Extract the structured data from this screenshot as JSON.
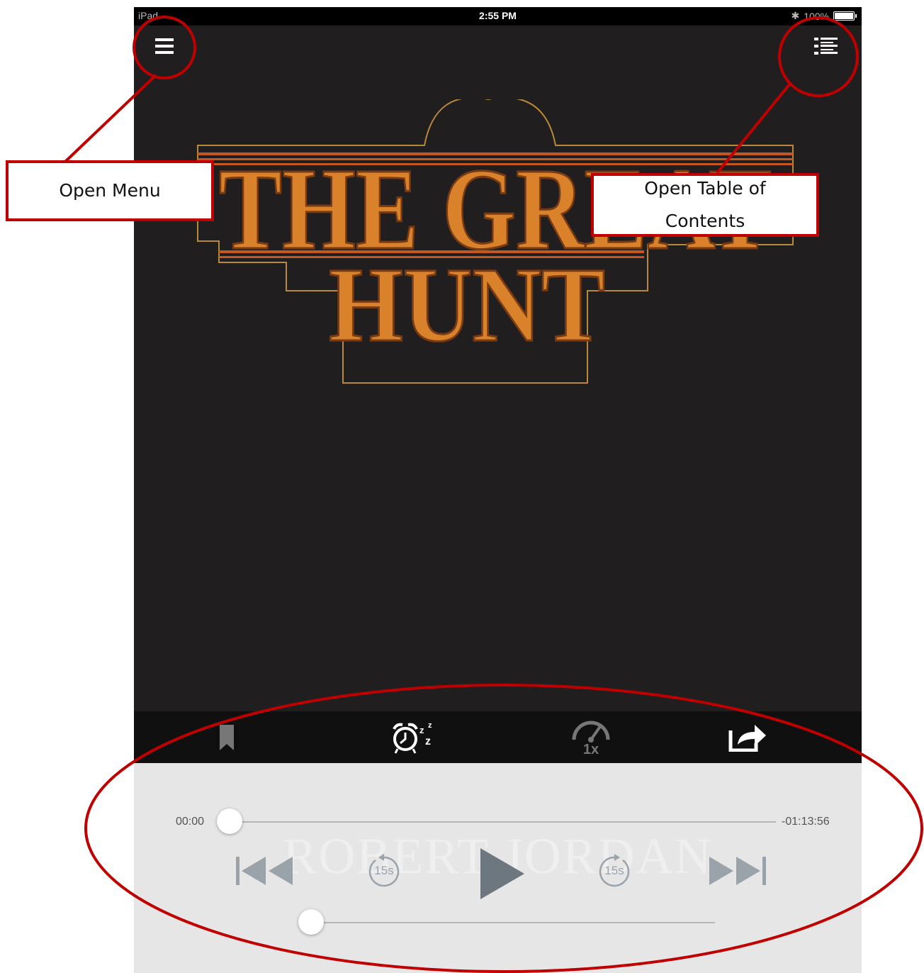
{
  "status_bar": {
    "device": "iPad",
    "time": "2:55 PM",
    "battery": "100%"
  },
  "cover": {
    "title_line1": "THE GREAT",
    "title_line2": "HUNT"
  },
  "toolbar": {
    "speed_label": "1x"
  },
  "player": {
    "elapsed": "00:00",
    "remaining": "-01:13:56",
    "skip_back_label": "15s",
    "skip_forward_label": "15s",
    "author_watermark": "ROBERT JORDAN",
    "progress": 0.0,
    "volume": 0.0
  },
  "annotations": {
    "menu_callout": "Open Menu",
    "toc_callout": "Open Table of Contents"
  },
  "colors": {
    "annotation_red": "#c00000",
    "cover_bg": "#201e1f",
    "cover_text": "#d9822b",
    "player_bg": "#e6e6e6",
    "controls": "#6d7780"
  }
}
